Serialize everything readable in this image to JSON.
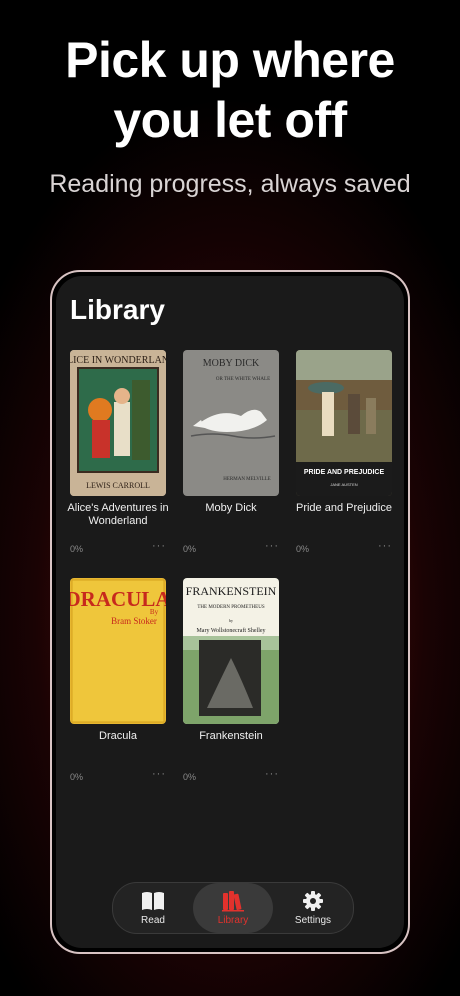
{
  "headline": [
    "Pick up where",
    "you let off"
  ],
  "subheadline": "Reading progress, always saved",
  "library": {
    "title": "Library",
    "books": [
      {
        "title": "Alice's Adventures in Wonderland",
        "cover_text": "ALICE IN WONDERLAND",
        "cover_author": "LEWIS CARROLL",
        "progress": "0%",
        "more": "···"
      },
      {
        "title": "Moby Dick",
        "cover_text": "MOBY DICK",
        "cover_sub": "OR THE WHITE WHALE",
        "cover_author": "HERMAN MELVILLE",
        "progress": "0%",
        "more": "···"
      },
      {
        "title": "Pride and Prejudice",
        "cover_text": "PRIDE AND PREJUDICE",
        "cover_author": "JANE AUSTEN",
        "progress": "0%",
        "more": "···"
      },
      {
        "title": "Dracula",
        "cover_text": "DRACULA",
        "cover_by": "By",
        "cover_author": "Bram Stoker",
        "progress": "0%",
        "more": "···"
      },
      {
        "title": "Frankenstein",
        "cover_text": "FRANKENSTEIN",
        "cover_sub": "THE MODERN PROMETHEUS",
        "cover_by": "by",
        "cover_author": "Mary Wollstonecraft Shelley",
        "progress": "0%",
        "more": "···"
      }
    ]
  },
  "tabs": [
    {
      "label": "Read",
      "icon": "book-open-icon",
      "active": false
    },
    {
      "label": "Library",
      "icon": "books-icon",
      "active": true
    },
    {
      "label": "Settings",
      "icon": "gear-icon",
      "active": false
    }
  ],
  "colors": {
    "accent": "#e2322d",
    "background_glow": "#7a0b12"
  }
}
